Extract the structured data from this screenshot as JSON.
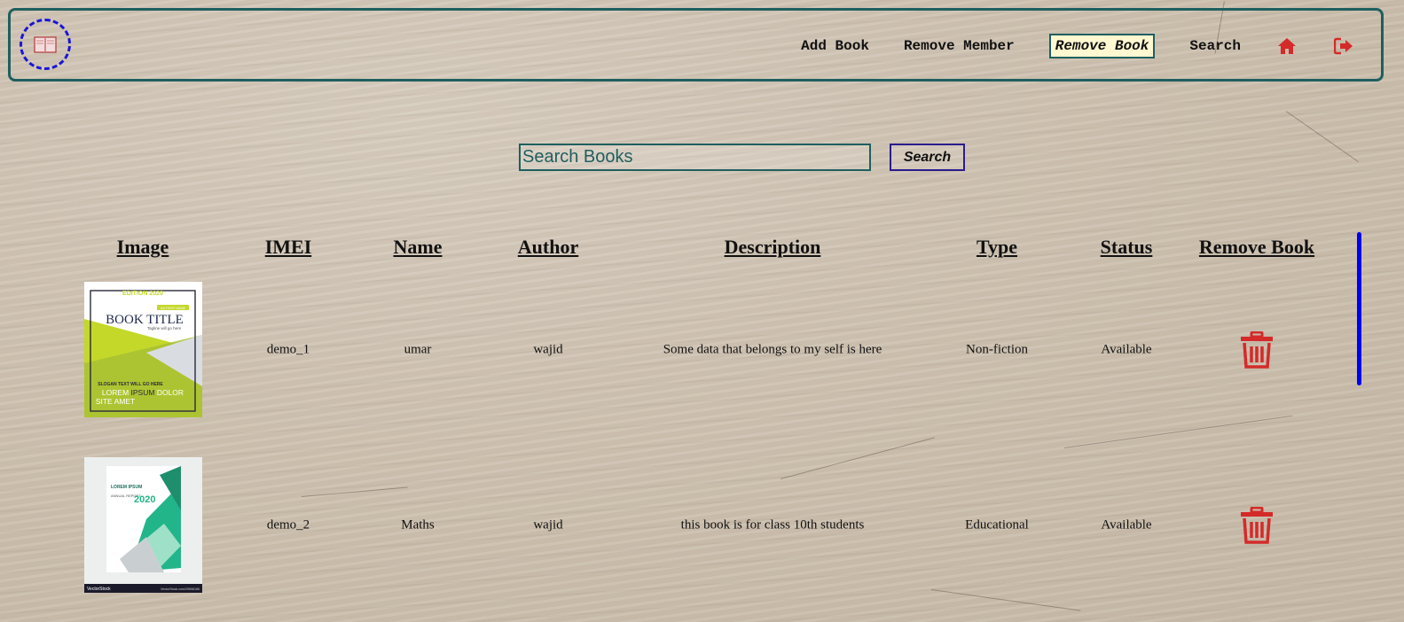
{
  "nav": {
    "logo_icon": "book-logo-icon",
    "links": [
      "Add Book",
      "Remove Member",
      "Remove Book",
      "Search"
    ],
    "active": "Remove Book",
    "home_icon": "home-icon",
    "logout_icon": "logout-icon",
    "icon_color": "#d42a2a"
  },
  "search": {
    "placeholder": "Search Books",
    "button_label": "Search"
  },
  "table": {
    "columns": [
      "Image",
      "IMEI",
      "Name",
      "Author",
      "Description",
      "Type",
      "Status",
      "Remove Book"
    ],
    "rows": [
      {
        "imei": "demo_1",
        "name": "umar",
        "author": "wajid",
        "description": "Some data that belongs to my self is here",
        "type": "Non-fiction",
        "status": "Available",
        "cover": {
          "edition": "EDITION 2020",
          "badge": "AUTHOR NAME",
          "title": "BOOK TITLE",
          "tagline": "Tagline will go here",
          "slogan": "SLOGAN TEXT WILL GO HERE",
          "lorem_1": "LOREM",
          "lorem_2": "IPSUM",
          "lorem_3": "DOLOR",
          "lorem_4": "SITE AMET"
        }
      },
      {
        "imei": "demo_2",
        "name": "Maths",
        "author": "wajid",
        "description": "this book is for class 10th students",
        "type": "Educational",
        "status": "Available",
        "cover": {
          "title": "LOREM IPSUM",
          "sub": "ANNUAL REPORT",
          "year": "2020",
          "footer_left": "VectorStock",
          "footer_right": "VectorStock.com/29696186"
        }
      }
    ]
  }
}
